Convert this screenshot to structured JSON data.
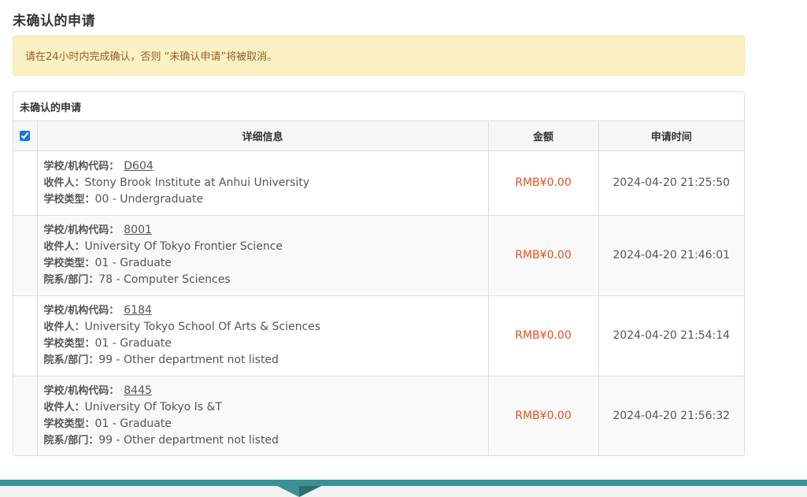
{
  "page": {
    "title": "未确认的申请",
    "notice": "请在24小时内完成确认，否则 “未确认申请”将被取消。"
  },
  "panel": {
    "heading": "未确认的申请",
    "columns": {
      "details": "详细信息",
      "amount": "金额",
      "time": "申请时间"
    }
  },
  "labels": {
    "code": "学校/机构代码：",
    "recipient": "收件人：",
    "school_type": "学校类型：",
    "department": "院系/部门："
  },
  "rows": [
    {
      "code": "D604",
      "recipient": "Stony Brook Institute at Anhui University",
      "school_type": "00 - Undergraduate",
      "department": null,
      "amount": "RMB¥0.00",
      "time": "2024-04-20 21:25:50"
    },
    {
      "code": "8001",
      "recipient": "University Of Tokyo Frontier Science",
      "school_type": "01 - Graduate",
      "department": "78 - Computer Sciences",
      "amount": "RMB¥0.00",
      "time": "2024-04-20 21:46:01"
    },
    {
      "code": "6184",
      "recipient": "University Tokyo School Of Arts & Sciences",
      "school_type": "01 - Graduate",
      "department": "99 - Other department not listed",
      "amount": "RMB¥0.00",
      "time": "2024-04-20 21:54:14"
    },
    {
      "code": "8445",
      "recipient": "University Of Tokyo Is &T",
      "school_type": "01 - Graduate",
      "department": "99 - Other department not listed",
      "amount": "RMB¥0.00",
      "time": "2024-04-20 21:56:32"
    }
  ],
  "colors": {
    "amount": "#e8501e",
    "notice_bg": "#fcf1c5",
    "footer_band": "#3a9094"
  }
}
